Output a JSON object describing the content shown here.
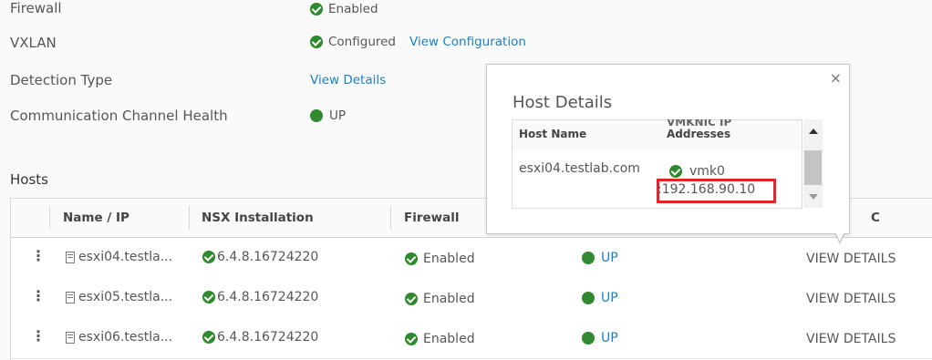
{
  "properties": [
    {
      "label": "Firewall",
      "value": "Enabled",
      "status": "check"
    },
    {
      "label": "VXLAN",
      "value": "Configured",
      "status": "check",
      "link": "View Configuration"
    },
    {
      "label": "Detection Type",
      "link": "View Details"
    },
    {
      "label": "Communication Channel Health",
      "value": "UP",
      "status": "dot"
    }
  ],
  "hosts": {
    "heading": "Hosts",
    "columns": [
      "Name / IP",
      "NSX Installation",
      "Firewall"
    ],
    "partial_column_tail": "C",
    "rows": [
      {
        "name": "esxi04.testla...",
        "nsx": "6.4.8.16724220",
        "firewall": "Enabled",
        "health": "UP",
        "action": "VIEW DETAILS"
      },
      {
        "name": "esxi05.testla...",
        "nsx": "6.4.8.16724220",
        "firewall": "Enabled",
        "health": "UP",
        "action": "VIEW DETAILS"
      },
      {
        "name": "esxi06.testla...",
        "nsx": "6.4.8.16724220",
        "firewall": "Enabled",
        "health": "UP",
        "action": "VIEW DETAILS"
      }
    ]
  },
  "popover": {
    "title": "Host Details",
    "close_glyph": "×",
    "col_host": "Host Name",
    "col_vmk_partial": "VMKNIC IP",
    "col_vmk_tail": "Addresses",
    "row": {
      "host": "esxi04.testlab.com",
      "vmk": "vmk0",
      "ip": ":192.168.90.10"
    }
  },
  "colors": {
    "accent": "#1b7fc4",
    "success": "#2d8a2d",
    "highlight": "#e0242a"
  }
}
